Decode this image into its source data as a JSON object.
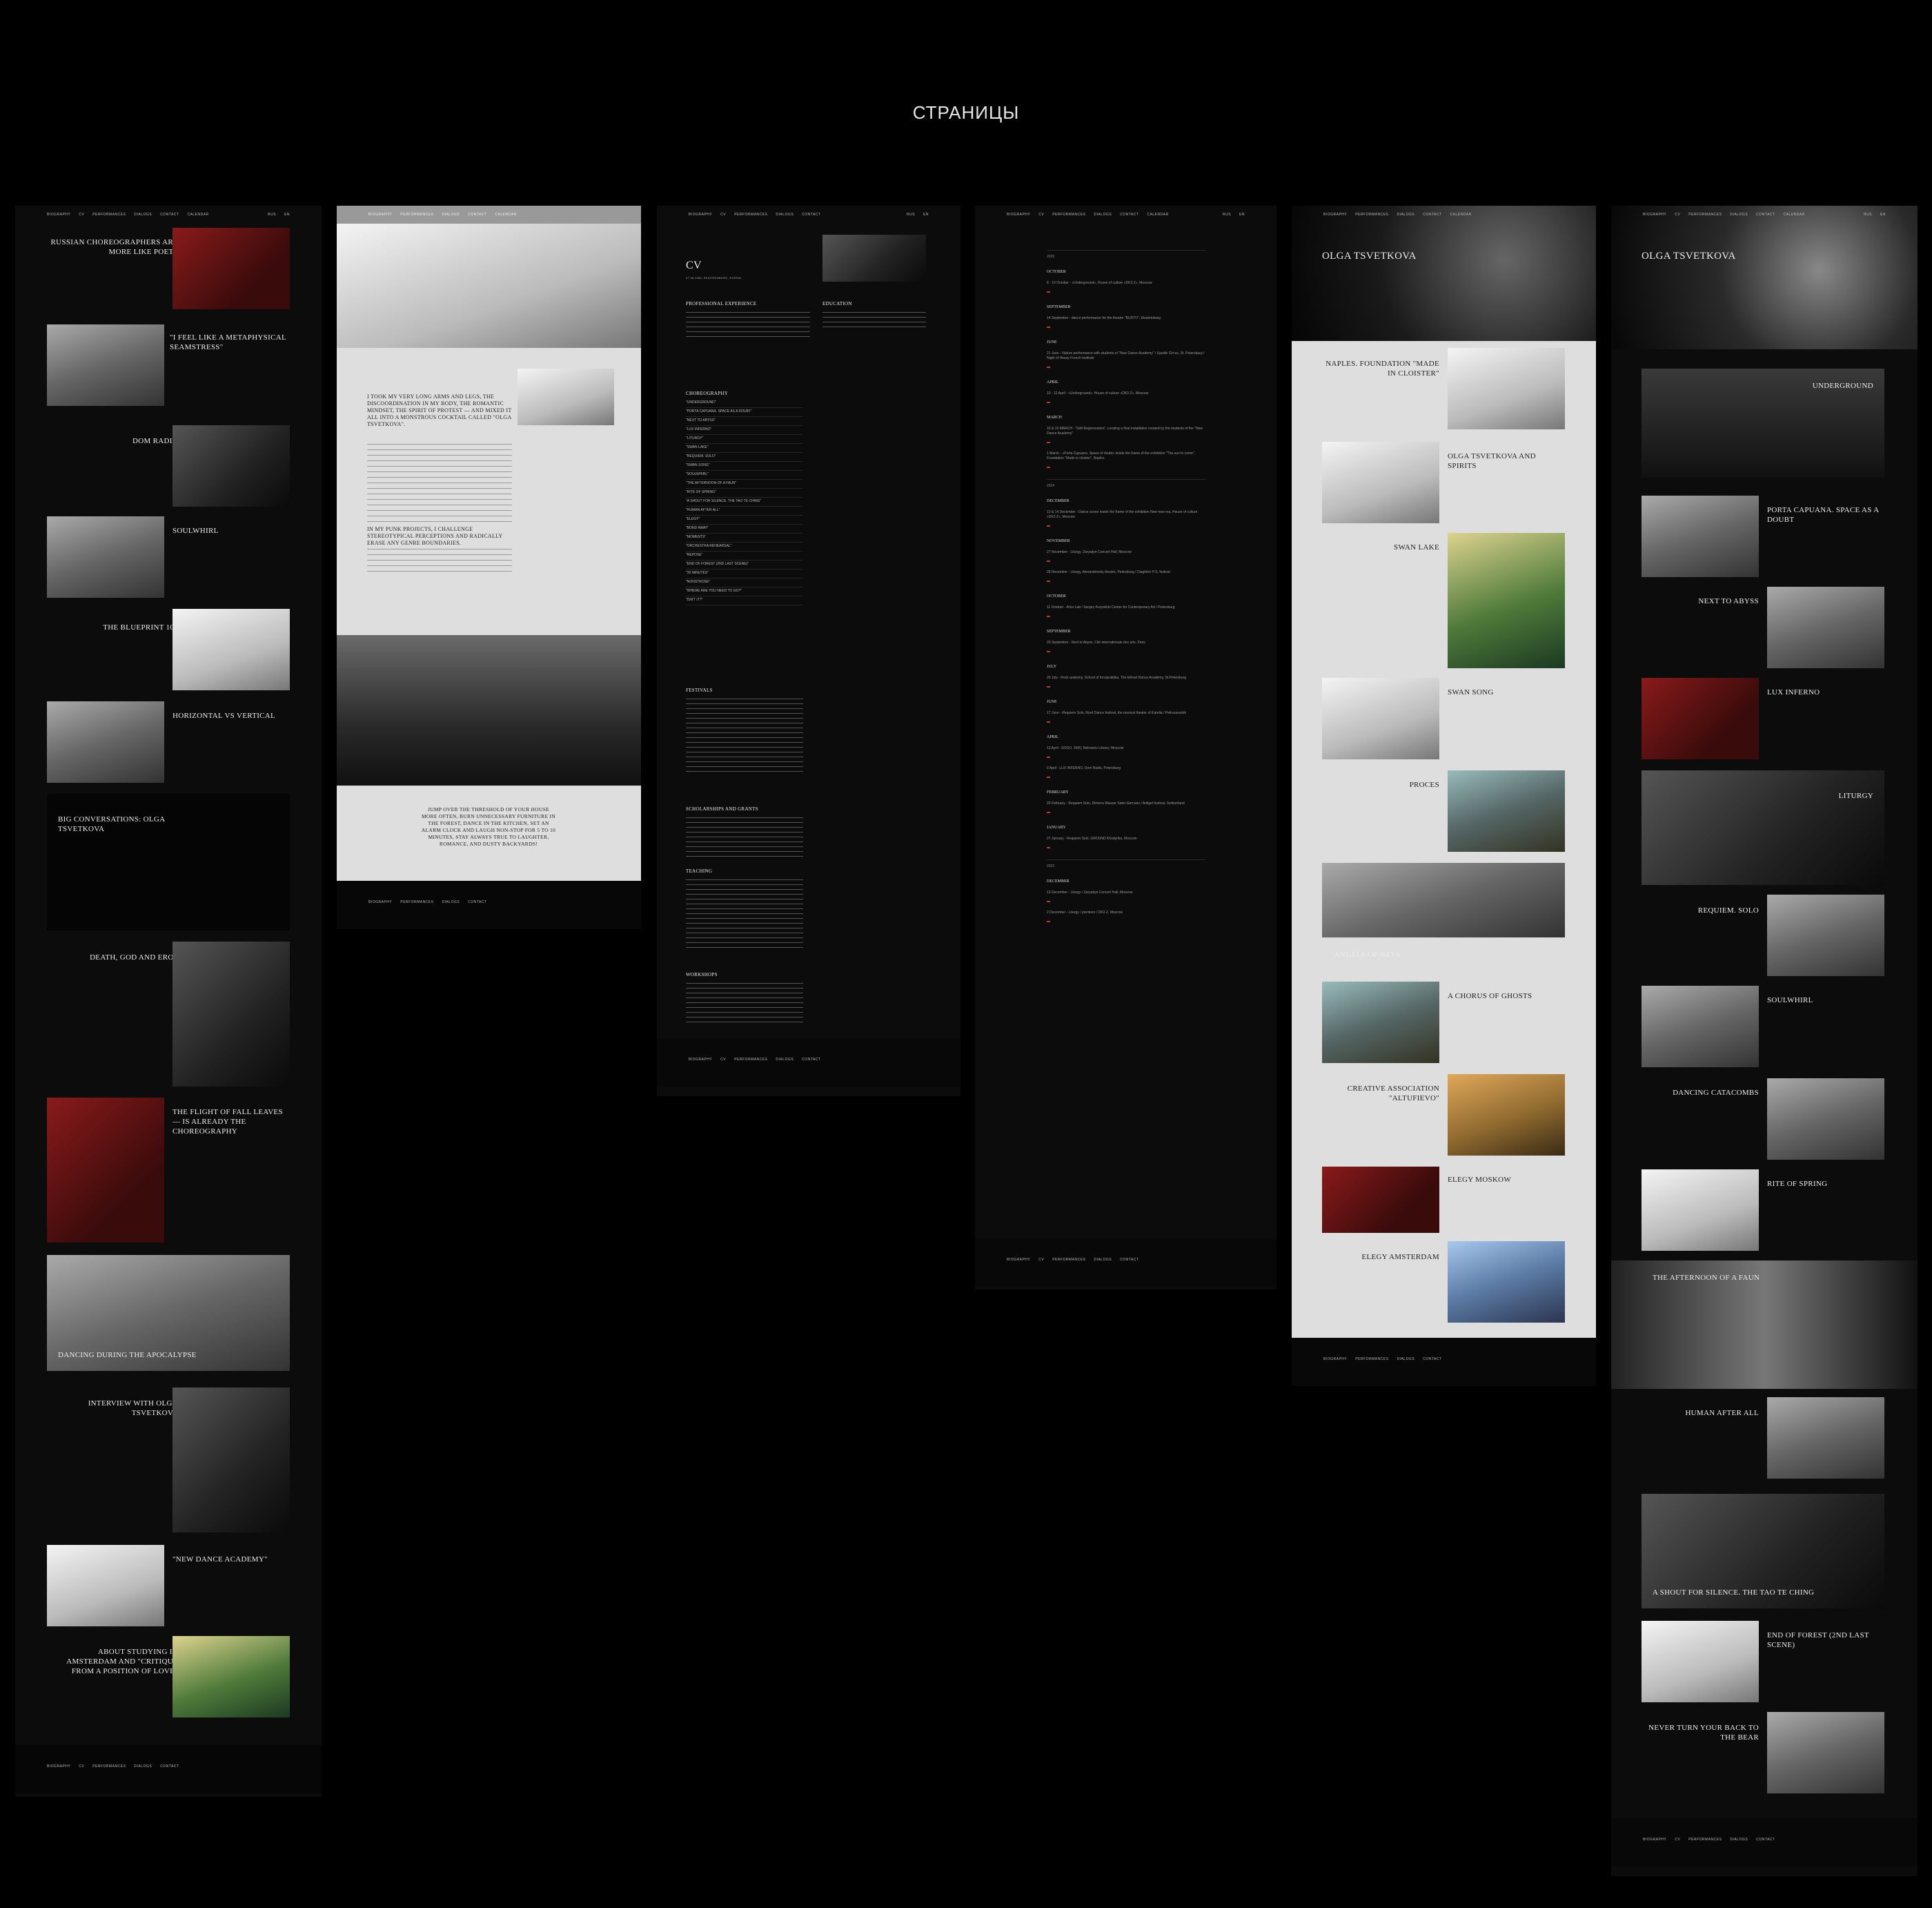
{
  "page_heading": "СТРАНИЦЫ",
  "colors": {
    "background": "#000000",
    "accent_red": "#c0392b",
    "light_panel": "#dedede",
    "dark_panel": "#0c0c0c"
  },
  "nav": {
    "items": [
      "BIOGRAPHY",
      "CV",
      "PERFORMANCES",
      "DIALOGS",
      "CONTACT",
      "CALENDAR"
    ],
    "lang": [
      "RUS",
      "EN"
    ]
  },
  "footer_nav": [
    "BIOGRAPHY",
    "CV",
    "PERFORMANCES",
    "DIALOGS",
    "CONTACT"
  ],
  "press": {
    "items": [
      {
        "title": "RUSSIAN CHOREOGRAPHERS ARE MORE LIKE POETS"
      },
      {
        "title": "\"I FEEL LIKE A METAPHYSICAL SEAMSTRESS\""
      },
      {
        "title": "DOM RADIO"
      },
      {
        "title": "SOULWHIRL"
      },
      {
        "title": "THE BLUEPRINT 100"
      },
      {
        "title": "HORIZONTAL VS VERTICAL"
      },
      {
        "title": "BIG CONVERSATIONS: OLGA TSVETKOVA"
      },
      {
        "title": "DEATH, GOD AND EROS"
      },
      {
        "title": "THE FLIGHT OF FALL LEAVES — IS ALREADY THE CHOREOGRAPHY"
      },
      {
        "title": "DANCING DURING THE APOCALYPSE"
      },
      {
        "title": "INTERVIEW WITH OLGA TSVETKOVA"
      },
      {
        "title": "\"NEW DANCE ACADEMY\""
      },
      {
        "title": "ABOUT STUDYING IN AMSTERDAM AND \"CRITIQUE FROM A POSITION OF LOVE\""
      }
    ]
  },
  "bio": {
    "headline1": "I TOOK MY VERY LONG ARMS AND LEGS, THE DISCOORDINATION IN MY BODY, THE ROMANTIC MINDSET, THE SPIRIT OF PROTEST — AND MIXED IT ALL INTO A MONSTROUS COCKTAIL CALLED \"OLGA TSVETKOVA\".",
    "headline2": "IN MY PUNK PROJECTS, I CHALLENGE STEREOTYPICAL PERCEPTIONS AND RADICALLY ERASE ANY GENRE BOUNDARIES.",
    "quote": "JUMP OVER THE THRESHOLD OF YOUR HOUSE MORE OFTEN, BURN UNNECESSARY FURNITURE IN THE FOREST, DANCE IN THE KITCHEN, SET AN ALARM CLOCK AND LAUGH NON-STOP FOR 5 TO 10 MINUTES, STAY ALWAYS TRUE TO LAUGHTER, ROMANCE, AND DUSTY BACKYARDS!"
  },
  "cv": {
    "title": "CV",
    "birth": "07.08.1984, EKATERINBURG, RUSSIA",
    "sections": [
      "PROFESSIONAL EXPERIENCE",
      "EDUCATION",
      "CHOREOGRAPHY",
      "FESTIVALS",
      "SCHOLARSHIPS AND GRANTS",
      "TEACHING",
      "WORKSHOPS"
    ],
    "choreography": [
      "\"UNDERGROUND\"",
      "\"PORTA CAPUANA. SPACE AS A DOUBT\"",
      "\"NEXT TO ABYSS\"",
      "\"LUX INFERNO\"",
      "\"LITURGY\"",
      "\"SWAN LAKE\"",
      "\"REQUIEM. SOLO\"",
      "\"SWAN SONG\"",
      "\"SOULWHIRL\"",
      "\"THE AFTERNOON OF A FAUN\"",
      "\"RITE OF SPRING\"",
      "\"A SHOUT FOR SILENCE. THE TAO TE CHING\"",
      "\"HUMAN AFTER ALL\"",
      "\"ELEGY\"",
      "\"BOND AWAY\"",
      "\"MOMENTS\"",
      "\"ORCHESTRA REHEARSAL\"",
      "\"REPOSE\"",
      "\"END OF FOREST (2ND LAST SCENE)\"",
      "\"20 MINUTES\"",
      "\"NONSTROSE\"",
      "\"WHERE ARE YOU NEED TO GO?\"",
      "\"ISN'T IT?\""
    ]
  },
  "calendar": {
    "years": [
      "2025",
      "2024",
      "2023"
    ],
    "months": [
      "OCTOBER",
      "SEPTEMBER",
      "JUNE",
      "APRIL",
      "MARCH",
      "DECEMBER",
      "NOVEMBER",
      "OCTOBER",
      "SEPTEMBER",
      "JULY",
      "JUNE",
      "APRIL",
      "FEBRUARY",
      "JANUARY",
      "DECEMBER"
    ],
    "events": [
      "8 - 10 October - «Underground», House of culture «DK3 Z», Moscow",
      "14 September - dance performance for the theatre \"BUDTO\", Ekaterinburg",
      "21 June - Nature performance with students of \"New Dance Academy\" / Upside Circus, St. Petersburg / Night of Heavy French Institute",
      "10 - 12 April - «Underground», House of culture «DK3 Z», Moscow",
      "15 & 16 MARCH - \"Self-Regeneration\", curating a final installation created by the students of the \"New Dance Academy\"",
      "1 March - «Porta Capuana. Space of doubt» inside the frame of the exhibition \"The sun to come\", Foundation \"Made in cloister\", Naples",
      "13 & 14 December - Dance scene inside the frame of the exhibition New new era, House of culture «DK3 Z», Moscow",
      "27 November - Liturgy, Zaryadye Concert Hall, Moscow",
      "28 November - Liturgy, Alexandrinsky theatre, Petersburg / Diaghilev P.S. festival",
      "11 October - Artur Lab / Sergey Kuryokhin Center for Contemporary Art / Petersburg",
      "29 September - Next to Abyss, Cité internationale des arts, Paris",
      "20 July - Rock anatomy, School of Innopraktika, The Ethnet Dance Academy, St.Petersburg",
      "17 June - Requiem Solo, Nord Dance festival, the musical theater of Karelia / Petrozavodsk",
      "13 April - SOGO. 3000, Nekrasov Library, Moscow",
      "9 April - LUX INFERNO, Dom Radio, Petersburg",
      "20 February - Requiem Solo, Dimena Wasser Sarin-Gerrusio / Antigel festival, Switzerland",
      "27 January - Requiem Solo, GROUND Khodynka, Moscow",
      "13 December - Liturgy / Zaryadye Concert Hall, Moscow",
      "2 December - Liturgy / premiere / DK3 Z, Moscow"
    ]
  },
  "performances_light": {
    "title": "OLGA TSVETKOVA",
    "items": [
      {
        "title": "NAPLES. FOUNDATION \"MADE IN CLOISTER\""
      },
      {
        "title": "OLGA TSVETKOVA AND SPIRITS"
      },
      {
        "title": "SWAN LAKE"
      },
      {
        "title": "SWAN SONG"
      },
      {
        "title": "PROCES"
      },
      {
        "title": "ANGELS OF NEVA"
      },
      {
        "title": "A CHORUS OF GHOSTS"
      },
      {
        "title": "CREATIVE ASSOCIATION \"ALTUFIEVO\""
      },
      {
        "title": "ELEGY MOSKOW"
      },
      {
        "title": "ELEGY AMSTERDAM"
      }
    ]
  },
  "performances_dark": {
    "title": "OLGA TSVETKOVA",
    "items": [
      {
        "title": "UNDERGROUND"
      },
      {
        "title": "PORTA CAPUANA. SPACE AS A DOUBT"
      },
      {
        "title": "NEXT TO ABYSS"
      },
      {
        "title": "LUX INFERNO"
      },
      {
        "title": "LITURGY"
      },
      {
        "title": "REQUIEM. SOLO"
      },
      {
        "title": "SOULWHIRL"
      },
      {
        "title": "DANCING CATACOMBS"
      },
      {
        "title": "RITE OF SPRING"
      },
      {
        "title": "THE AFTERNOON OF A FAUN"
      },
      {
        "title": "HUMAN AFTER ALL"
      },
      {
        "title": "A SHOUT FOR SILENCE. THE TAO TE CHING"
      },
      {
        "title": "END OF FOREST (2ND LAST SCENE)"
      },
      {
        "title": "NEVER TURN YOUR BACK TO THE BEAR"
      }
    ]
  }
}
